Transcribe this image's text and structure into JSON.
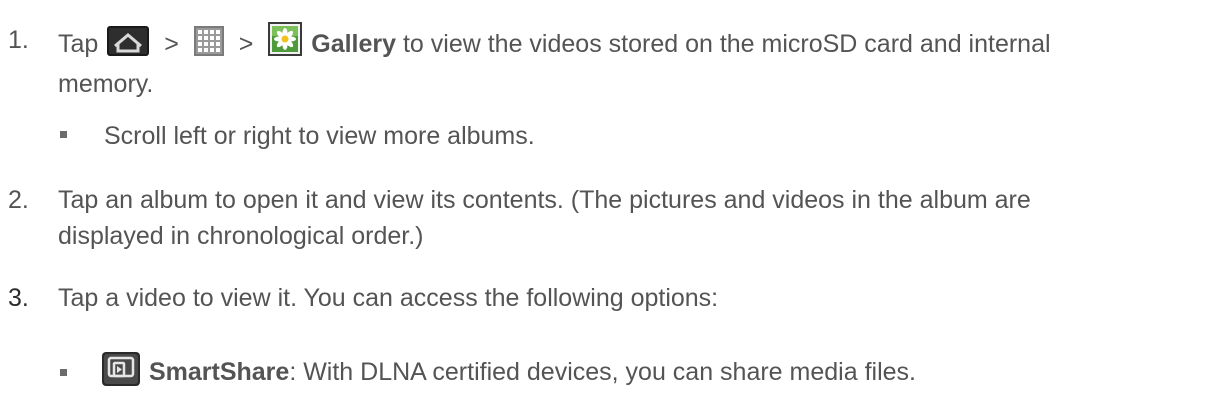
{
  "steps": [
    {
      "number": "1.",
      "tap": "Tap",
      "sep1": ">",
      "sep2": ">",
      "bold_label": "Gallery",
      "line1_rest": " to view the videos stored on the microSD card and internal",
      "line2": "memory.",
      "icons": [
        "home-icon",
        "apps-grid-icon",
        "gallery-icon"
      ]
    },
    {
      "number": "2.",
      "line1": "Tap an album to open it and view its contents. (The pictures and videos in the album are",
      "line2": "displayed in chronological order.)"
    },
    {
      "number": "3.",
      "line1": "Tap a video to view it. You can access the following options:"
    }
  ],
  "bullets": [
    {
      "text": "Scroll left or right to view more albums."
    },
    {
      "bold_label": "SmartShare",
      "text": ": With DLNA certified devices, you can share media files.",
      "icon": "smartshare-icon"
    }
  ],
  "colors": {
    "text": "#545454",
    "bullet": "#6b6b6b"
  }
}
